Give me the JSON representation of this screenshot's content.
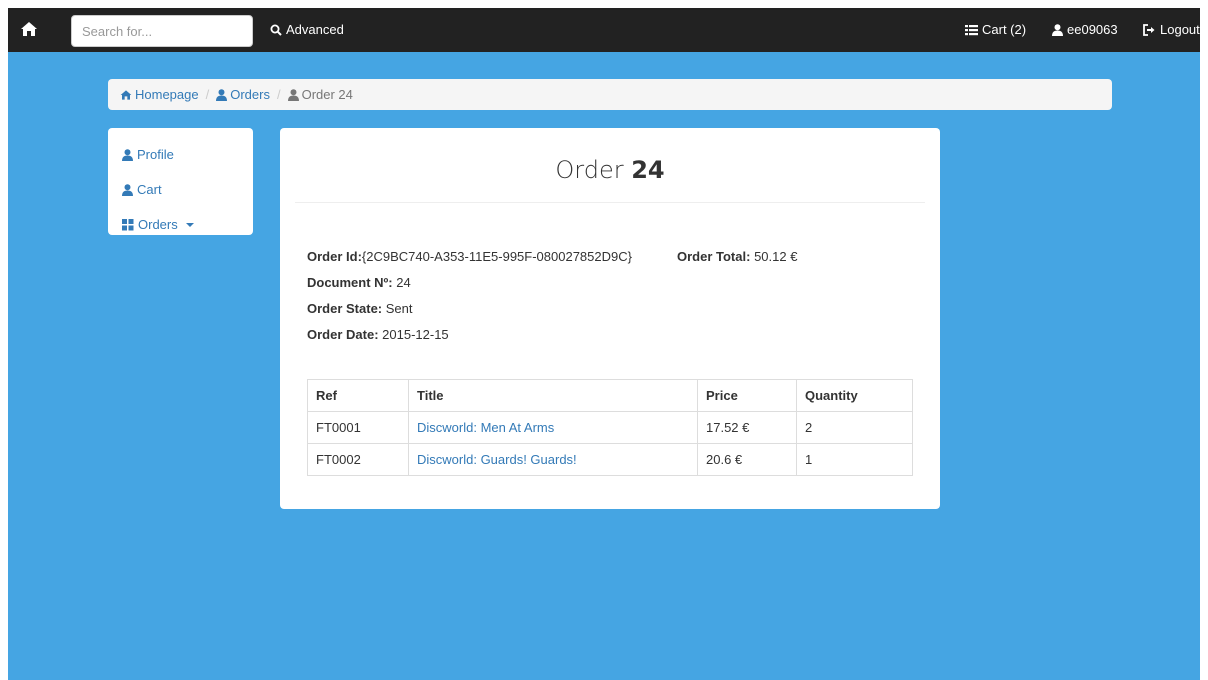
{
  "topbar": {
    "search_placeholder": "Search for...",
    "advanced_label": "Advanced",
    "cart_label": "Cart (2)",
    "user_label": "ee09063",
    "logout_label": "Logout"
  },
  "breadcrumb": {
    "home": "Homepage",
    "orders": "Orders",
    "current": "Order 24"
  },
  "sidebar": {
    "items": [
      {
        "label": "Profile",
        "icon": "user-icon"
      },
      {
        "label": "Cart",
        "icon": "user-icon"
      },
      {
        "label": "Orders",
        "icon": "grid-icon"
      }
    ]
  },
  "order": {
    "title_prefix": "Order",
    "title_number": "24",
    "id_label": "Order Id:",
    "id_value": "{2C9BC740-A353-11E5-995F-080027852D9C}",
    "total_label": "Order Total:",
    "total_value": "50.12 €",
    "doc_label": "Document Nº:",
    "doc_value": "24",
    "state_label": "Order State:",
    "state_value": "Sent",
    "date_label": "Order Date:",
    "date_value": "2015-12-15"
  },
  "table": {
    "headers": [
      "Ref",
      "Title",
      "Price",
      "Quantity"
    ],
    "rows": [
      {
        "ref": "FT0001",
        "title": "Discworld: Men At Arms",
        "price": "17.52 €",
        "quantity": "2"
      },
      {
        "ref": "FT0002",
        "title": "Discworld: Guards! Guards!",
        "price": "20.6 €",
        "quantity": "1"
      }
    ]
  },
  "colors": {
    "background": "#45a5e3",
    "navbar": "#222222",
    "link": "#337ab7"
  }
}
